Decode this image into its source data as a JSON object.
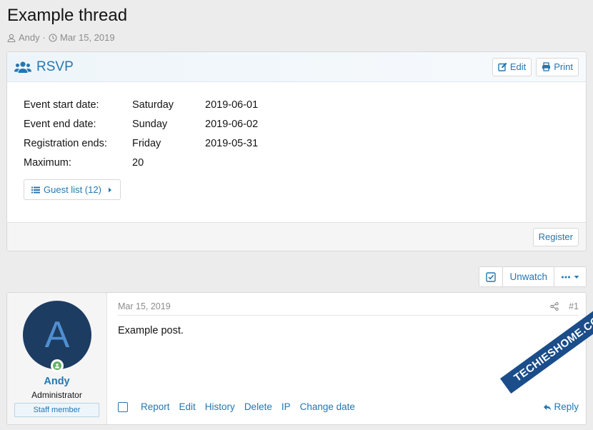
{
  "thread": {
    "title": "Example thread",
    "author": "Andy",
    "separator": "·",
    "date": "Mar 15, 2019"
  },
  "rsvp": {
    "title": "RSVP",
    "edit_label": "Edit",
    "print_label": "Print",
    "rows": [
      {
        "label": "Event start date:",
        "day": "Saturday",
        "date": "2019-06-01"
      },
      {
        "label": "Event end date:",
        "day": "Sunday",
        "date": "2019-06-02"
      },
      {
        "label": "Registration ends:",
        "day": "Friday",
        "date": "2019-05-31"
      },
      {
        "label": "Maximum:",
        "day": "20",
        "date": ""
      }
    ],
    "guest_list_label": "Guest list (12)",
    "register_label": "Register"
  },
  "watch_bar": {
    "unwatch_label": "Unwatch"
  },
  "post": {
    "user": {
      "avatar_letter": "A",
      "name": "Andy",
      "title": "Administrator",
      "badge": "Staff member"
    },
    "date": "Mar 15, 2019",
    "number": "#1",
    "text": "Example post.",
    "actions": [
      "Report",
      "Edit",
      "History",
      "Delete",
      "IP",
      "Change date"
    ],
    "reply_label": "Reply"
  },
  "watermark": "TECHIESHOME.COM",
  "colors": {
    "accent": "#2577b1",
    "background": "#ececec",
    "avatar_bg": "#1d3c62",
    "online": "#63b265"
  }
}
